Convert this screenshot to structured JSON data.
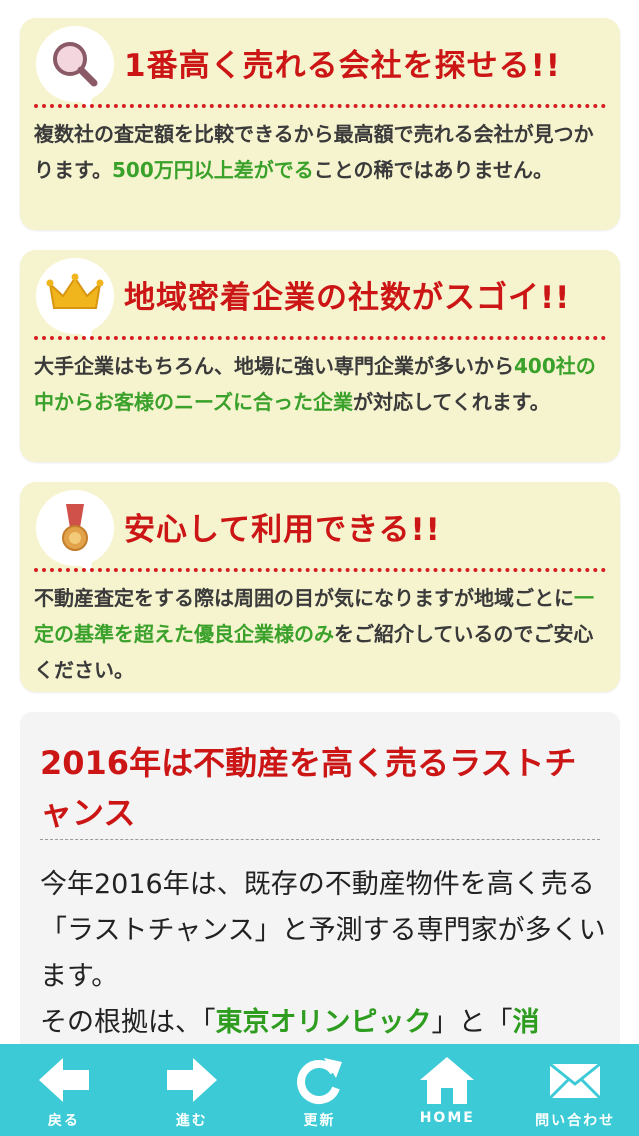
{
  "cards": [
    {
      "icon": "magnifier-icon",
      "title": "1番高く売れる会社を探せる!!",
      "body": [
        {
          "t": "複数社の査定額を比較できるから最高額で売れる会社が見つかります。",
          "g": false
        },
        {
          "t": "500万円以上差がでる",
          "g": true
        },
        {
          "t": "ことの稀ではありません。",
          "g": false
        }
      ]
    },
    {
      "icon": "crown-icon",
      "title": "地域密着企業の社数がスゴイ!!",
      "body": [
        {
          "t": "大手企業はもちろん、地場に強い専門企業が多いから",
          "g": false
        },
        {
          "t": "400社の中からお客様のニーズに合った企業",
          "g": true
        },
        {
          "t": "が対応してくれます。",
          "g": false
        }
      ]
    },
    {
      "icon": "medal-icon",
      "title": "安心して利用できる!!",
      "body": [
        {
          "t": "不動産査定をする際は周囲の目が気になりますが地域ごとに",
          "g": false
        },
        {
          "t": "一定の基準を超えた優良企業様のみ",
          "g": true
        },
        {
          "t": "をご紹介しているのでご安心ください。",
          "g": false
        }
      ]
    }
  ],
  "article": {
    "title": "2016年は不動産を高く売るラストチャンス",
    "para1": "今年2016年は、既存の不動産物件を高く売る「ラストチャンス」と予測する専門家が多くいます。",
    "para2_prefix": "その根拠は、「",
    "para2_kw1": "東京オリンピック",
    "para2_mid": "」と「",
    "para2_kw2": "消"
  },
  "tabbar": {
    "items": [
      {
        "label": "戻る",
        "icon": "back-arrow-icon"
      },
      {
        "label": "進む",
        "icon": "forward-arrow-icon"
      },
      {
        "label": "更新",
        "icon": "refresh-icon"
      },
      {
        "label": "HOME",
        "icon": "home-icon"
      },
      {
        "label": "問い合わせ",
        "icon": "mail-icon"
      }
    ]
  },
  "colors": {
    "accent_red": "#cc1616",
    "accent_green": "#3aa12a",
    "card_bg": "#f6f3cf",
    "tabbar_bg": "#3ccbd6"
  }
}
